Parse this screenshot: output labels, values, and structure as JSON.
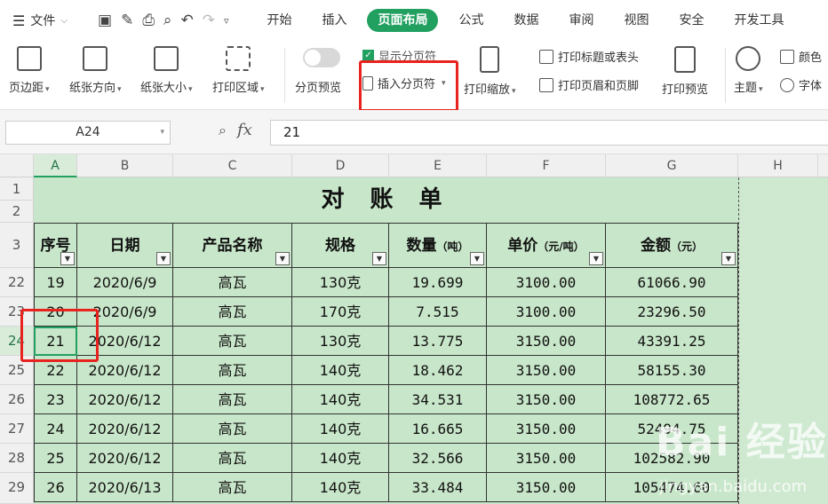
{
  "menu": {
    "file_label": "文件",
    "tabs": [
      {
        "label": "开始",
        "active": false
      },
      {
        "label": "插入",
        "active": false
      },
      {
        "label": "页面布局",
        "active": true
      },
      {
        "label": "公式",
        "active": false
      },
      {
        "label": "数据",
        "active": false
      },
      {
        "label": "审阅",
        "active": false
      },
      {
        "label": "视图",
        "active": false
      },
      {
        "label": "安全",
        "active": false
      },
      {
        "label": "开发工具",
        "active": false
      }
    ]
  },
  "ribbon": {
    "page_margin": "页边距",
    "orientation": "纸张方向",
    "paper_size": "纸张大小",
    "print_area": "打印区域",
    "page_break_preview": "分页预览",
    "show_page_break": "显示分页符",
    "insert_page_break": "插入分页符",
    "print_scale": "打印缩放",
    "print_titles": "打印标题或表头",
    "print_header_footer": "打印页眉和页脚",
    "print_preview": "打印预览",
    "theme": "主题",
    "color": "颜色",
    "font": "字体"
  },
  "formula_bar": {
    "name_box": "A24",
    "fx_label": "fx",
    "value": "21"
  },
  "columns": [
    "A",
    "B",
    "C",
    "D",
    "E",
    "F",
    "G",
    "H"
  ],
  "sheet": {
    "title": "对 账 单",
    "headers": [
      {
        "main": "序号",
        "sub": ""
      },
      {
        "main": "日期",
        "sub": ""
      },
      {
        "main": "产品名称",
        "sub": ""
      },
      {
        "main": "规格",
        "sub": ""
      },
      {
        "main": "数量",
        "sub": "（吨）"
      },
      {
        "main": "单价",
        "sub": "（元/吨）"
      },
      {
        "main": "金额",
        "sub": "（元）"
      }
    ],
    "rows": [
      {
        "row": "22",
        "cells": [
          "19",
          "2020/6/9",
          "高瓦",
          "130克",
          "19.699",
          "3100.00",
          "61066.90"
        ]
      },
      {
        "row": "23",
        "cells": [
          "20",
          "2020/6/9",
          "高瓦",
          "170克",
          "7.515",
          "3100.00",
          "23296.50"
        ]
      },
      {
        "row": "24",
        "cells": [
          "21",
          "2020/6/12",
          "高瓦",
          "130克",
          "13.775",
          "3150.00",
          "43391.25"
        ]
      },
      {
        "row": "25",
        "cells": [
          "22",
          "2020/6/12",
          "高瓦",
          "140克",
          "18.462",
          "3150.00",
          "58155.30"
        ]
      },
      {
        "row": "26",
        "cells": [
          "23",
          "2020/6/12",
          "高瓦",
          "140克",
          "34.531",
          "3150.00",
          "108772.65"
        ]
      },
      {
        "row": "27",
        "cells": [
          "24",
          "2020/6/12",
          "高瓦",
          "140克",
          "16.665",
          "3150.00",
          "52494.75"
        ]
      },
      {
        "row": "28",
        "cells": [
          "25",
          "2020/6/12",
          "高瓦",
          "140克",
          "32.566",
          "3150.00",
          "102582.90"
        ]
      },
      {
        "row": "29",
        "cells": [
          "26",
          "2020/6/13",
          "高瓦",
          "140克",
          "33.484",
          "3150.00",
          "105474.60"
        ]
      }
    ],
    "top_rows": [
      "1",
      "2",
      "3"
    ]
  },
  "watermark": {
    "main": "Bai 经验",
    "sub": "jingyan.baidu.com"
  },
  "colors": {
    "accent": "#21a060",
    "highlight": "#e8231f",
    "sheet_bg": "#c8e6c9"
  }
}
